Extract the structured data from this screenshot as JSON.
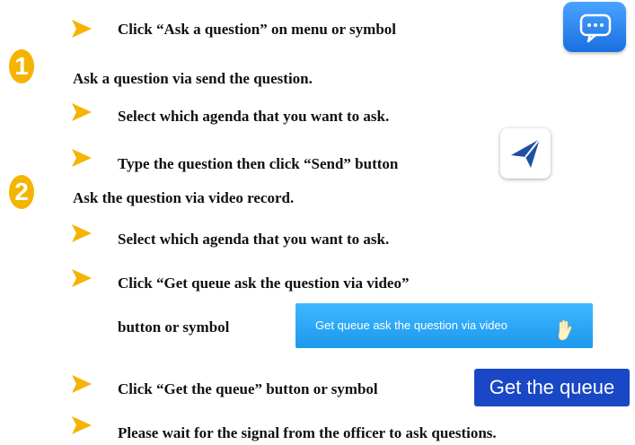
{
  "colors": {
    "bullet": "#f5b400",
    "step_badge": "#f5b400",
    "chat_icon_bg": "#1a6fe0",
    "video_button_bg": "#1c98ee",
    "queue_button_bg": "#1947c6"
  },
  "intro": {
    "text": "Click “Ask a question” on menu or symbol",
    "icon": "chat-bubble-icon"
  },
  "step1": {
    "number": "1",
    "title": "Ask a question via send the question.",
    "items": [
      "Select which agenda that you want to ask.",
      "Type the question then click “Send” button"
    ],
    "send_icon": "paper-plane-icon"
  },
  "step2": {
    "number": "2",
    "title": "Ask the question via video record.",
    "items": [
      "Select which agenda that you want to ask.",
      "Click “Get queue ask the question via video”",
      "button or symbol",
      "Click “Get the queue” button or symbol",
      "Please wait for the signal from the officer to ask questions."
    ],
    "video_button_label": "Get queue ask the question via video",
    "video_button_icon": "raised-hand-icon",
    "queue_button_label": "Get the queue"
  }
}
